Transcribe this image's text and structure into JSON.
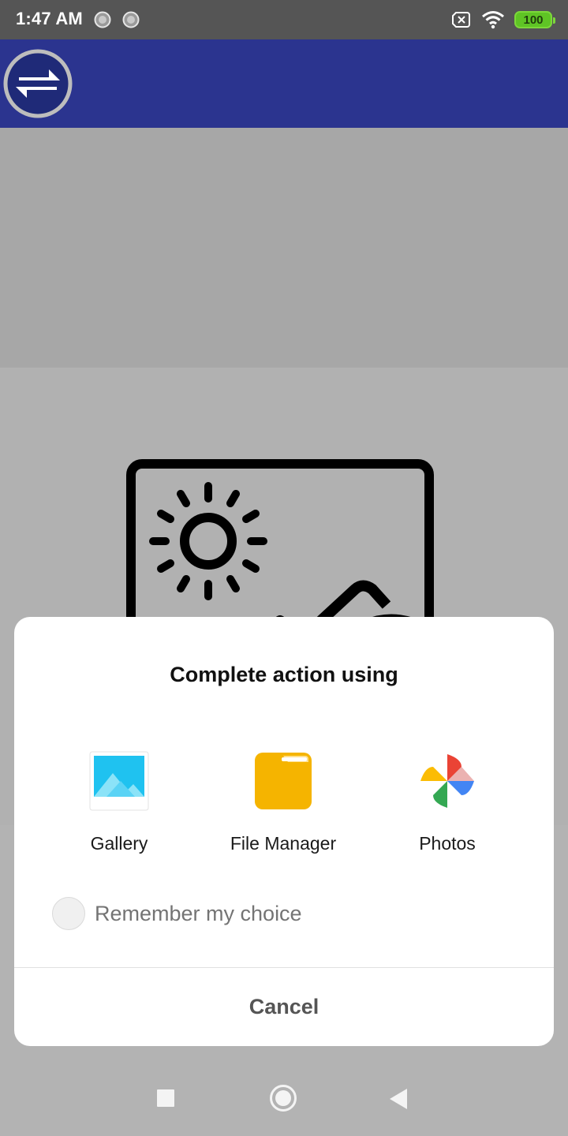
{
  "status_bar": {
    "time": "1:47 AM",
    "battery_level": "100",
    "icons": [
      "notification-dot-icon",
      "notification-dot-icon",
      "no-sim-icon",
      "wifi-icon",
      "battery-icon"
    ]
  },
  "app_bar": {
    "background_color": "#2b348f",
    "icon": "swap-arrows-icon"
  },
  "content": {
    "image_placeholder": "image-placeholder-icon"
  },
  "dialog": {
    "title": "Complete action using",
    "apps": [
      {
        "label": "Gallery",
        "icon": "gallery-icon"
      },
      {
        "label": "File Manager",
        "icon": "file-manager-icon"
      },
      {
        "label": "Photos",
        "icon": "photos-icon"
      }
    ],
    "remember_label": "Remember my choice",
    "cancel_label": "Cancel"
  },
  "nav_bar": {
    "icons": [
      "recents-icon",
      "home-icon",
      "back-icon"
    ]
  },
  "colors": {
    "status_bar": "#555555",
    "app_bar": "#2b348f",
    "scrim": "#b3b3b3",
    "battery": "#5fc425",
    "file_manager": "#f5b400"
  }
}
